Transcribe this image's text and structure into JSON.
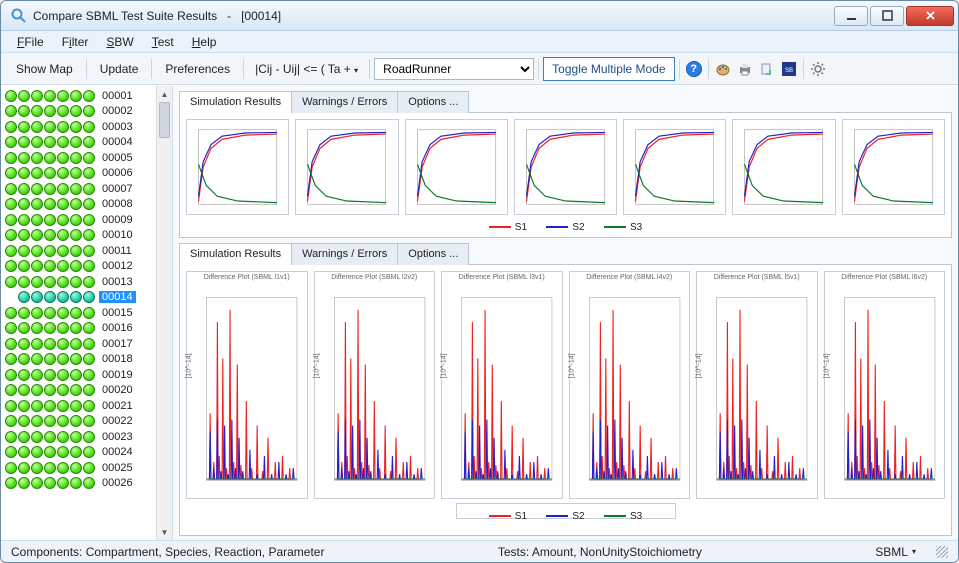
{
  "window": {
    "app_title": "Compare SBML Test Suite Results",
    "doc_sep": "-",
    "doc_id": "[00014]"
  },
  "menu": [
    "File",
    "Filter",
    "SBW",
    "Test",
    "Help"
  ],
  "toolbar": {
    "show_map": "Show Map",
    "update": "Update",
    "preferences": "Preferences",
    "formula": "|Cij - Uij| <= ( Ta + ",
    "simulator_options": [
      "RoadRunner"
    ],
    "simulator_selected": "RoadRunner",
    "toggle": "Toggle Multiple Mode",
    "icons": [
      "help-icon",
      "palette-icon",
      "printer-icon",
      "export-icon",
      "sbml-icon",
      "gear-icon"
    ]
  },
  "sidebar": {
    "count": 26,
    "selected": "00014",
    "rows": [
      {
        "id": "00001",
        "dots": [
          1,
          1,
          1,
          1,
          1,
          1,
          1
        ]
      },
      {
        "id": "00002",
        "dots": [
          1,
          1,
          1,
          1,
          1,
          1,
          1
        ]
      },
      {
        "id": "00003",
        "dots": [
          1,
          1,
          1,
          1,
          1,
          1,
          1
        ]
      },
      {
        "id": "00004",
        "dots": [
          1,
          1,
          1,
          1,
          1,
          1,
          1
        ]
      },
      {
        "id": "00005",
        "dots": [
          1,
          1,
          1,
          1,
          1,
          1,
          1
        ]
      },
      {
        "id": "00006",
        "dots": [
          1,
          1,
          1,
          1,
          1,
          1,
          1
        ]
      },
      {
        "id": "00007",
        "dots": [
          1,
          1,
          1,
          1,
          1,
          1,
          1
        ]
      },
      {
        "id": "00008",
        "dots": [
          1,
          1,
          1,
          1,
          1,
          1,
          1
        ]
      },
      {
        "id": "00009",
        "dots": [
          1,
          1,
          1,
          1,
          1,
          1,
          1
        ]
      },
      {
        "id": "00010",
        "dots": [
          1,
          1,
          1,
          1,
          1,
          1,
          1
        ]
      },
      {
        "id": "00011",
        "dots": [
          1,
          1,
          1,
          1,
          1,
          1,
          1
        ]
      },
      {
        "id": "00012",
        "dots": [
          1,
          1,
          1,
          1,
          1,
          1,
          1
        ]
      },
      {
        "id": "00013",
        "dots": [
          1,
          1,
          1,
          1,
          1,
          1,
          1
        ]
      },
      {
        "id": "00014",
        "dots": [
          0,
          2,
          2,
          2,
          2,
          2,
          2
        ]
      },
      {
        "id": "00015",
        "dots": [
          1,
          1,
          1,
          1,
          1,
          1,
          1
        ]
      },
      {
        "id": "00016",
        "dots": [
          1,
          1,
          1,
          1,
          1,
          1,
          1
        ]
      },
      {
        "id": "00017",
        "dots": [
          1,
          1,
          1,
          1,
          1,
          1,
          1
        ]
      },
      {
        "id": "00018",
        "dots": [
          1,
          1,
          1,
          1,
          1,
          1,
          1
        ]
      },
      {
        "id": "00019",
        "dots": [
          1,
          1,
          1,
          1,
          1,
          1,
          1
        ]
      },
      {
        "id": "00020",
        "dots": [
          1,
          1,
          1,
          1,
          1,
          1,
          1
        ]
      },
      {
        "id": "00021",
        "dots": [
          1,
          1,
          1,
          1,
          1,
          1,
          1
        ]
      },
      {
        "id": "00022",
        "dots": [
          1,
          1,
          1,
          1,
          1,
          1,
          1
        ]
      },
      {
        "id": "00023",
        "dots": [
          1,
          1,
          1,
          1,
          1,
          1,
          1
        ]
      },
      {
        "id": "00024",
        "dots": [
          1,
          1,
          1,
          1,
          1,
          1,
          1
        ]
      },
      {
        "id": "00025",
        "dots": [
          1,
          1,
          1,
          1,
          1,
          1,
          1
        ]
      },
      {
        "id": "00026",
        "dots": [
          1,
          1,
          1,
          1,
          1,
          1,
          1
        ]
      }
    ]
  },
  "tabs_upper": [
    "Simulation Results",
    "Warnings / Errors",
    "Options ..."
  ],
  "tabs_lower": [
    "Simulation Results",
    "Warnings / Errors",
    "Options ..."
  ],
  "legend": [
    "S1",
    "S2",
    "S3"
  ],
  "status": {
    "components": "Components: Compartment, Species, Reaction, Parameter",
    "tests": "Tests: Amount, NonUnityStoichiometry",
    "level": "SBML"
  },
  "chart_data": {
    "upper": {
      "type": "line",
      "xlim": [
        0,
        5
      ],
      "ylim": [
        0,
        1.4
      ],
      "series": [
        {
          "name": "S1",
          "color": "#e22",
          "values": [
            [
              0,
              0.05
            ],
            [
              0.3,
              0.7
            ],
            [
              0.8,
              1.05
            ],
            [
              1.5,
              1.22
            ],
            [
              3,
              1.3
            ],
            [
              5,
              1.32
            ]
          ]
        },
        {
          "name": "S2",
          "color": "#22c",
          "values": [
            [
              0,
              0.15
            ],
            [
              0.3,
              0.8
            ],
            [
              0.8,
              1.12
            ],
            [
              1.5,
              1.28
            ],
            [
              3,
              1.34
            ],
            [
              5,
              1.35
            ]
          ]
        },
        {
          "name": "S3",
          "color": "#0a7a2a",
          "values": [
            [
              0,
              0.75
            ],
            [
              0.5,
              0.35
            ],
            [
              1.2,
              0.15
            ],
            [
              2.5,
              0.06
            ],
            [
              5,
              0.03
            ]
          ]
        }
      ],
      "count": 7
    },
    "lower": {
      "type": "line",
      "title_prefix": "Difference Plot",
      "xlim": [
        0,
        50
      ],
      "ylim": [
        0,
        3.0
      ],
      "ylabel": "[10^-14]",
      "series_colors": {
        "S1": "#e22",
        "S2": "#22c",
        "S3": "#0a7a2a"
      },
      "series": [
        {
          "name": "S1",
          "x": [
            2,
            4,
            6,
            7,
            9,
            11,
            13,
            15,
            17,
            19,
            22,
            25,
            28,
            31,
            34,
            38,
            42,
            46
          ],
          "y": [
            1.1,
            0.3,
            2.6,
            0.4,
            2.0,
            0.2,
            2.8,
            0.3,
            1.9,
            0.25,
            1.3,
            0.2,
            0.9,
            0.15,
            0.7,
            0.3,
            0.4,
            0.2
          ]
        },
        {
          "name": "S2",
          "x": [
            2,
            4,
            6,
            8,
            10,
            12,
            14,
            16,
            18,
            20,
            24,
            28,
            32,
            36,
            40,
            44,
            48
          ],
          "y": [
            0.8,
            0.2,
            1.0,
            0.15,
            0.9,
            0.1,
            1.0,
            0.2,
            0.7,
            0.15,
            0.5,
            0.1,
            0.4,
            0.1,
            0.3,
            0.1,
            0.2
          ]
        },
        {
          "name": "S3",
          "x": [
            0,
            50
          ],
          "y": [
            0.02,
            0.02
          ]
        }
      ],
      "count": 6
    }
  }
}
